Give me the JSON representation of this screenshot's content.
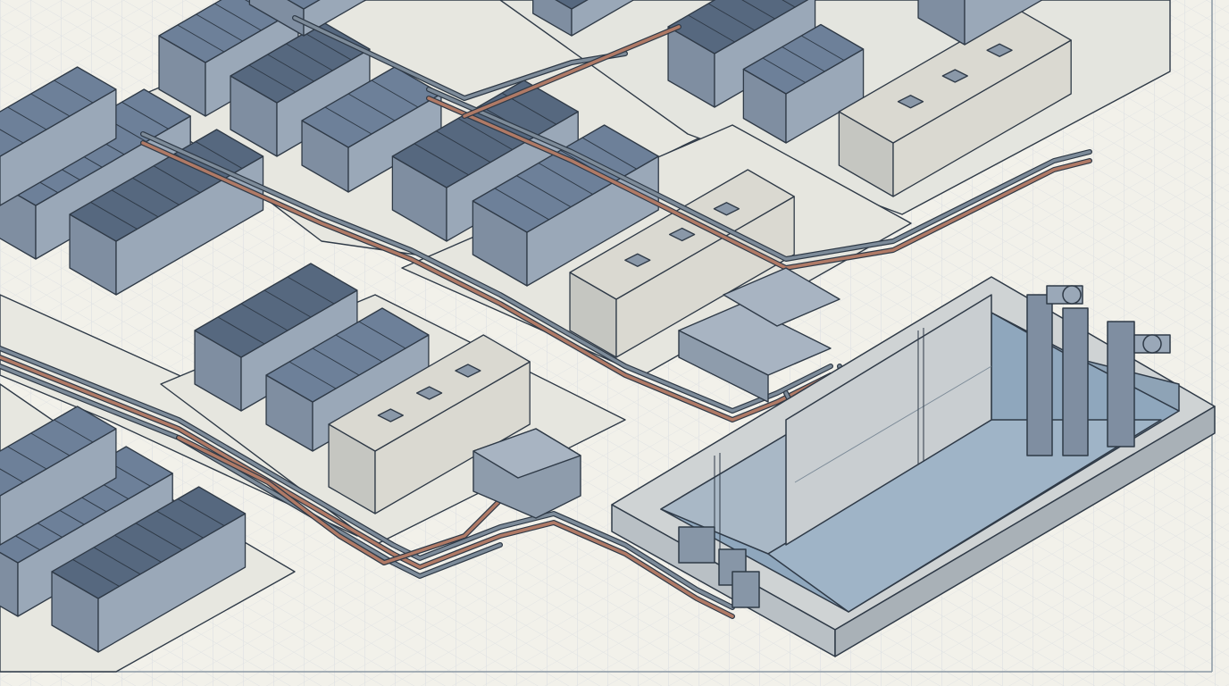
{
  "colors": {
    "paper": "#f2f1ea",
    "grid": "#d9dde0",
    "frame": "#8a97a3",
    "roof_dark": "#56687f",
    "roof_mid": "#6d8099",
    "wall_front": "#9aa8b8",
    "wall_side": "#7f8ea1",
    "wall_light": "#dad9d1",
    "wall_light_side": "#c5c6c1",
    "concrete": "#c9cdcf",
    "concrete_dark": "#aeb5ba",
    "basin_water": "#9eb3c6",
    "basin_shadow": "#8aa1b6",
    "pipe_grey": "#7d8b99",
    "pipe_copper": "#b07a66",
    "outline": "#2f3a47"
  },
  "icons": [
    "roof-hatch-icon",
    "ladder-icon",
    "pump-icon",
    "valve-icon"
  ]
}
